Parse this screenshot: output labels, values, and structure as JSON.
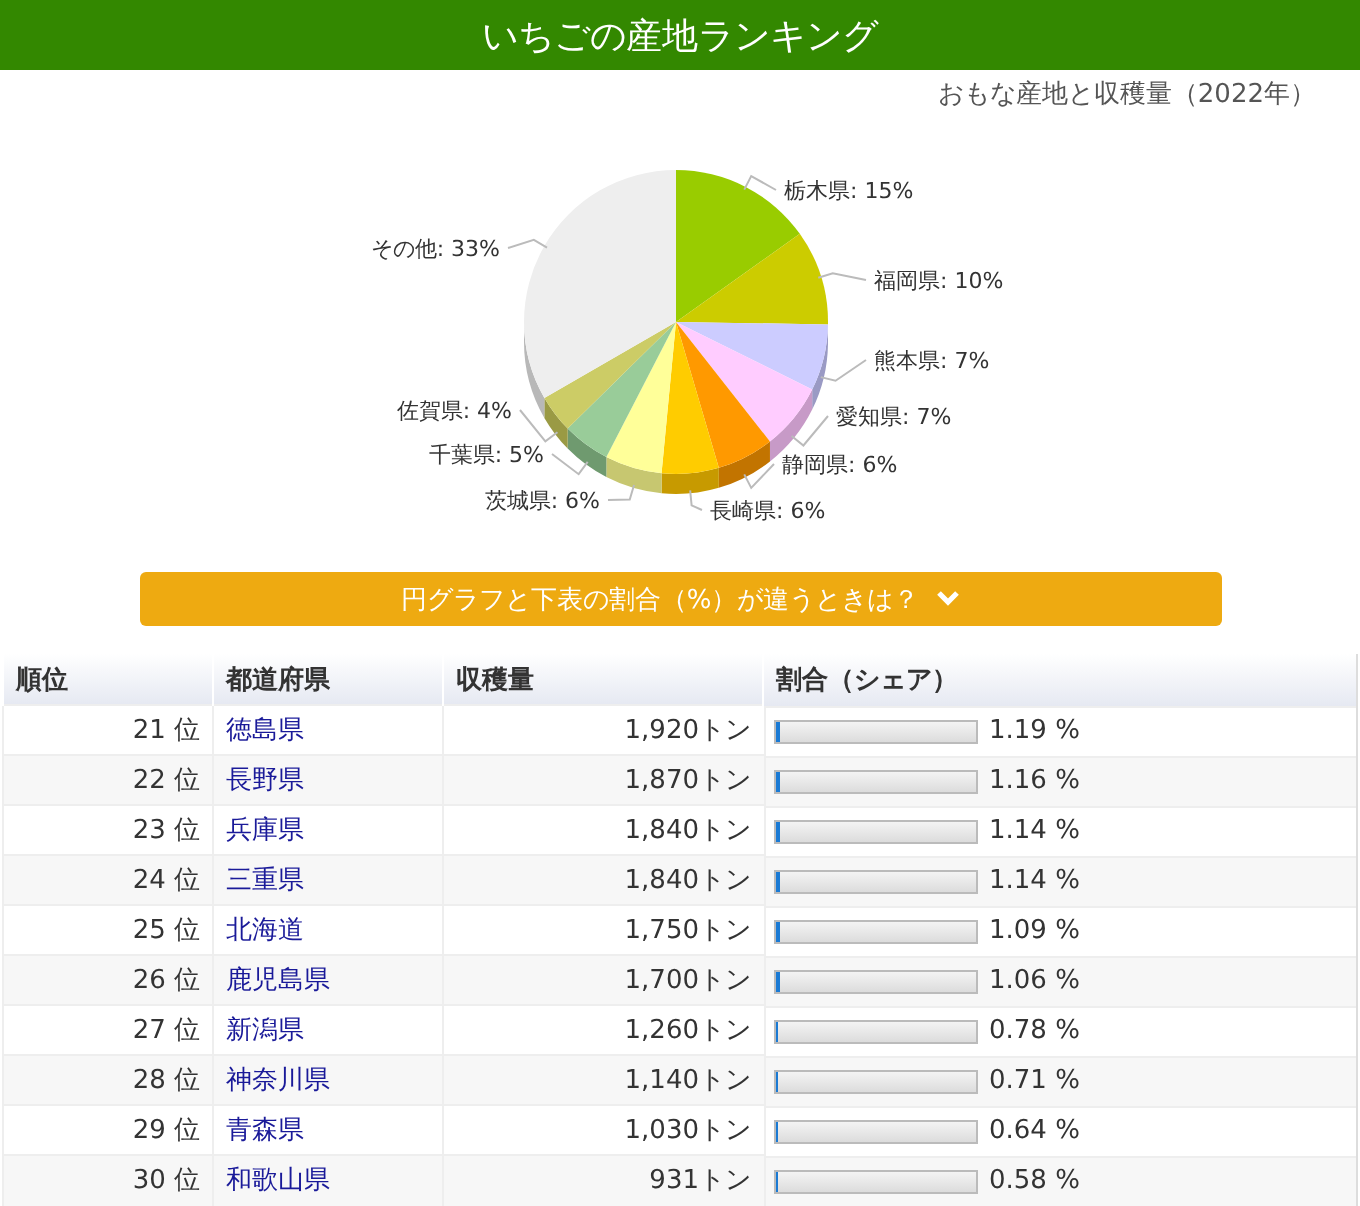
{
  "title": "いちごの産地ランキング",
  "subtitle": "おもな産地と収穫量（2022年）",
  "chart_data": {
    "type": "pie",
    "values": [
      15,
      10,
      7,
      7,
      6,
      6,
      6,
      5,
      4,
      33
    ],
    "value_labels": [
      "栃木県: 15%",
      "福岡県: 10%",
      "熊本県: 7%",
      "愛知県: 7%",
      "静岡県: 6%",
      "長崎県: 6%",
      "茨城県: 6%",
      "千葉県: 5%",
      "佐賀県: 4%",
      "その他: 33%"
    ]
  },
  "toggle_button": {
    "label": "円グラフと下表の割合（%）が違うときは？",
    "expanded": false
  },
  "table": {
    "columns": [
      "順位",
      "都道府県",
      "収穫量",
      "割合（シェア）"
    ],
    "rows": [
      {
        "rank": "21 位",
        "prefecture": "徳島県",
        "amount": "1,920トン",
        "level": 0.02,
        "share": "1.19 %"
      },
      {
        "rank": "22 位",
        "prefecture": "長野県",
        "amount": "1,870トン",
        "level": 0.02,
        "share": "1.16 %"
      },
      {
        "rank": "23 位",
        "prefecture": "兵庫県",
        "amount": "1,840トン",
        "level": 0.02,
        "share": "1.14 %"
      },
      {
        "rank": "24 位",
        "prefecture": "三重県",
        "amount": "1,840トン",
        "level": 0.02,
        "share": "1.14 %"
      },
      {
        "rank": "25 位",
        "prefecture": "北海道",
        "amount": "1,750トン",
        "level": 0.02,
        "share": "1.09 %"
      },
      {
        "rank": "26 位",
        "prefecture": "鹿児島県",
        "amount": "1,700トン",
        "level": 0.02,
        "share": "1.06 %"
      },
      {
        "rank": "27 位",
        "prefecture": "新潟県",
        "amount": "1,260トン",
        "level": 0.01,
        "share": "0.78 %"
      },
      {
        "rank": "28 位",
        "prefecture": "神奈川県",
        "amount": "1,140トン",
        "level": 0.01,
        "share": "0.71 %"
      },
      {
        "rank": "29 位",
        "prefecture": "青森県",
        "amount": "1,030トン",
        "level": 0.01,
        "share": "0.64 %"
      },
      {
        "rank": "30 位",
        "prefecture": "和歌山県",
        "amount": "931トン",
        "level": 0.01,
        "share": "0.58 %"
      }
    ]
  }
}
